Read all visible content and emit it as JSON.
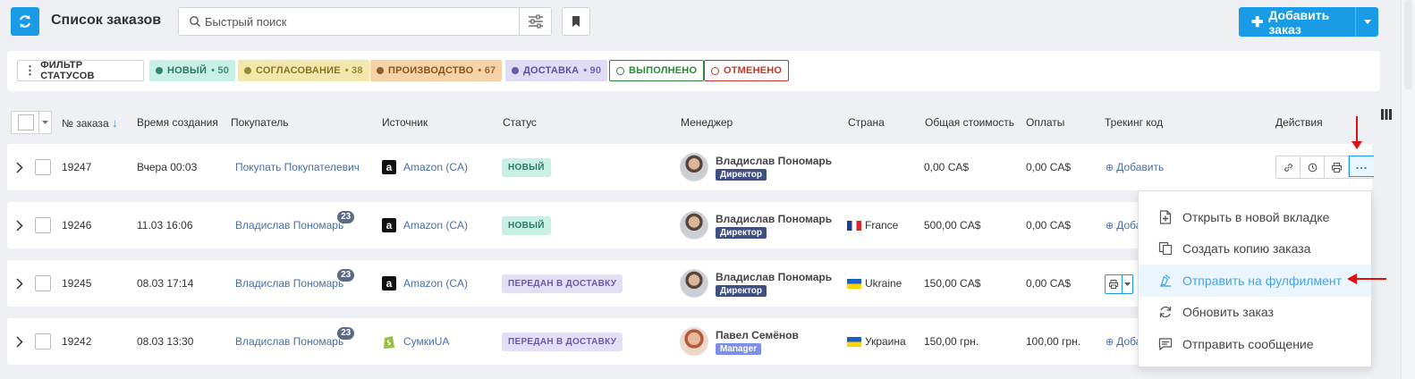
{
  "header": {
    "title": "Список заказов",
    "search_placeholder": "Быстрый поиск",
    "add_order_label": "Добавить заказ"
  },
  "filters": {
    "filter_label": "ФИЛЬТР СТАТУСОВ",
    "chips": [
      {
        "label": "НОВЫЙ",
        "count": "• 50",
        "bg": "#c9f0e4",
        "color": "#2c7a63",
        "dot": "#2c8a6e",
        "outline": false
      },
      {
        "label": "СОГЛАСОВАНИЕ",
        "count": "• 38",
        "bg": "#f3e7ae",
        "color": "#8a7520",
        "dot": "#9c8a3a",
        "outline": false
      },
      {
        "label": "ПРОИЗВОДСТВО",
        "count": "• 67",
        "bg": "#f6d3a6",
        "color": "#8a5520",
        "dot": "#8e5e2c",
        "outline": false
      },
      {
        "label": "ДОСТАВКА",
        "count": "• 90",
        "bg": "#e1dcf6",
        "color": "#5e50a0",
        "dot": "#6a5aa8",
        "outline": false
      },
      {
        "label": "ВЫПОЛНЕНО",
        "count": "",
        "bg": "#ffffff",
        "color": "#2a8a3a",
        "dot": "#2a8a3a",
        "outline": true
      },
      {
        "label": "ОТМЕНЕНО",
        "count": "",
        "bg": "#ffffff",
        "color": "#c0392b",
        "dot": "#c0392b",
        "outline": true
      }
    ]
  },
  "columns": {
    "order_no": "№ заказа",
    "created": "Время создания",
    "buyer": "Покупатель",
    "source": "Источник",
    "status": "Статус",
    "manager": "Менеджер",
    "country": "Страна",
    "total": "Общая стоимость",
    "payments": "Оплаты",
    "tracking": "Трекинг код",
    "actions": "Действия"
  },
  "rows": [
    {
      "id": "19247",
      "created": "Вчера 00:03",
      "buyer": "Покупать Покупателевич",
      "buyer_count": "",
      "source": "Amazon (CA)",
      "source_icon": "amazon-icon",
      "status": "НОВЫЙ",
      "status_type": "new",
      "manager": "Владислав Пономарь",
      "role": "Директор",
      "country": "",
      "flag": "",
      "total": "0,00 CA$",
      "payments": "0,00 CA$",
      "tracking": "Добавить"
    },
    {
      "id": "19246",
      "created": "11.03 16:06",
      "buyer": "Владислав Пономарь",
      "buyer_count": "23",
      "source": "Amazon (CA)",
      "source_icon": "amazon-icon",
      "status": "НОВЫЙ",
      "status_type": "new",
      "manager": "Владислав Пономарь",
      "role": "Директор",
      "country": "France",
      "flag": "fr",
      "total": "500,00 CA$",
      "payments": "0,00 CA$",
      "tracking": "Доба"
    },
    {
      "id": "19245",
      "created": "08.03 17:14",
      "buyer": "Владислав Пономарь",
      "buyer_count": "23",
      "source": "Amazon (CA)",
      "source_icon": "amazon-icon",
      "status": "ПЕРЕДАН В ДОСТАВКУ",
      "status_type": "del",
      "manager": "Владислав Пономарь",
      "role": "Директор",
      "country": "Ukraine",
      "flag": "ua",
      "total": "150,00 CA$",
      "payments": "0,00 CA$",
      "tracking": ""
    },
    {
      "id": "19242",
      "created": "08.03 13:30",
      "buyer": "Владислав Пономарь",
      "buyer_count": "23",
      "source": "СумкиUA",
      "source_icon": "shopify-icon",
      "status": "ПЕРЕДАН В ДОСТАВКУ",
      "status_type": "del",
      "manager": "Павел Семёнов",
      "role": "Manager",
      "country": "Украина",
      "flag": "ua",
      "total": "150,00 грн.",
      "payments": "100,00 грн.",
      "tracking": "Доба"
    }
  ],
  "menu": {
    "items": [
      {
        "label": "Открыть в новой вкладке",
        "icon": "open-new-tab-icon"
      },
      {
        "label": "Создать копию заказа",
        "icon": "copy-icon"
      },
      {
        "label": "Отправить на фулфилмент",
        "icon": "fulfillment-icon"
      },
      {
        "label": "Обновить заказ",
        "icon": "refresh-icon"
      },
      {
        "label": "Отправить сообщение",
        "icon": "message-icon"
      }
    ]
  }
}
